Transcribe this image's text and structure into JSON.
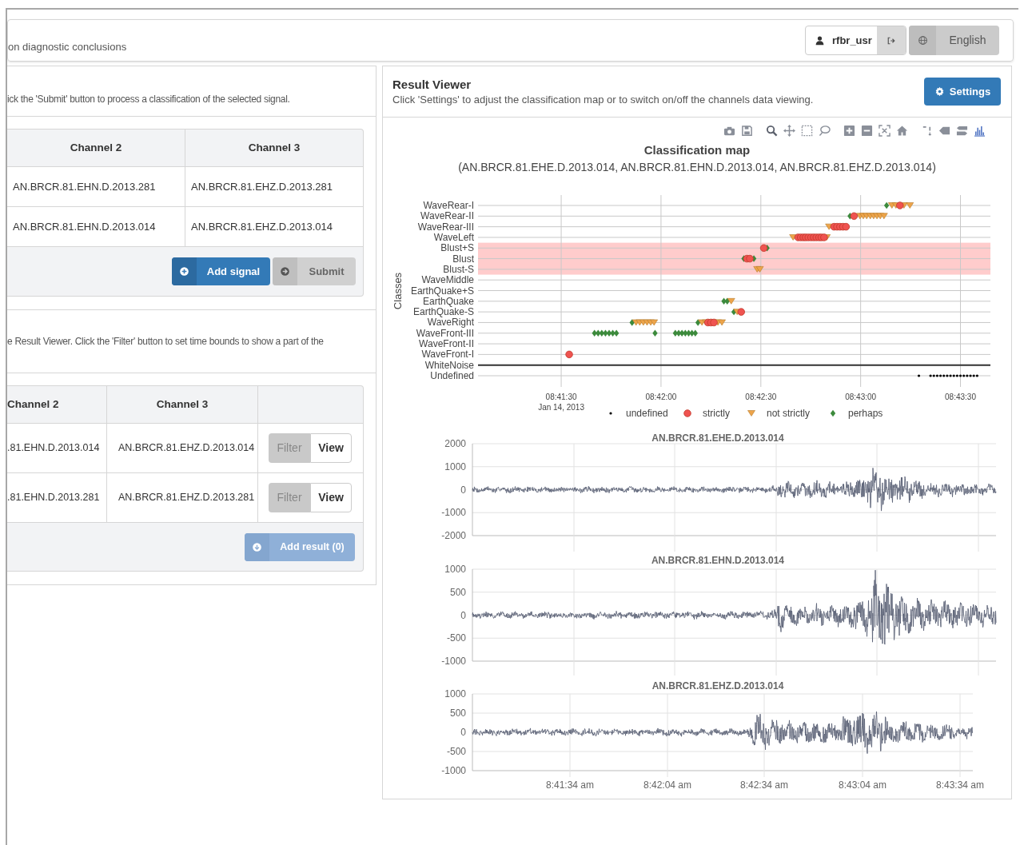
{
  "header": {
    "breadcrumb": "on diagnostic conclusions",
    "username": "rfbr_usr",
    "language": "English"
  },
  "signals_panel": {
    "hint": "ick the 'Submit' button to process a classification of the selected signal.",
    "table": {
      "columns": [
        "Channel 2",
        "Channel 3"
      ],
      "rows": [
        [
          "AN.BRCR.81.EHN.D.2013.281",
          "AN.BRCR.81.EHZ.D.2013.281"
        ],
        [
          "AN.BRCR.81.EHN.D.2013.014",
          "AN.BRCR.81.EHZ.D.2013.014"
        ]
      ]
    },
    "buttons": [
      {
        "label": "Add signal",
        "kind": "primary"
      },
      {
        "label": "Submit",
        "kind": "default"
      }
    ]
  },
  "results_panel": {
    "hint": "e Result Viewer. Click the 'Filter' button to set time bounds to show a part of the",
    "table": {
      "columns": [
        "Channel 2",
        "Channel 3"
      ],
      "rows": [
        {
          "cells": [
            ".81.EHN.D.2013.014",
            "AN.BRCR.81.EHZ.D.2013.014"
          ],
          "actions": [
            {
              "label": "Filter",
              "kind": "toggle"
            },
            {
              "label": "View",
              "kind": "outline"
            }
          ]
        },
        {
          "cells": [
            ".81.EHN.D.2013.281",
            "AN.BRCR.81.EHZ.D.2013.281"
          ],
          "actions": [
            {
              "label": "Filter",
              "kind": "toggle"
            },
            {
              "label": "View",
              "kind": "outline"
            }
          ]
        }
      ]
    },
    "add_button": {
      "label": "Add result (0)",
      "disabled": true
    }
  },
  "result_viewer": {
    "title": "Result Viewer",
    "subtitle": "Click 'Settings' to adjust the classification map or to switch on/off the channels data viewing.",
    "settings_button": "Settings",
    "classification_map": {
      "title": "Classification map",
      "subtitle": "(AN.BRCR.81.EHE.D.2013.014, AN.BRCR.81.EHN.D.2013.014, AN.BRCR.81.EHZ.D.2013.014)",
      "y_title": "Classes",
      "classes": [
        "WaveRear-I",
        "WaveRear-II",
        "WaveRear-III",
        "WaveLeft",
        "Blust+S",
        "Blust",
        "Blust-S",
        "WaveMiddle",
        "EarthQuake+S",
        "EarthQuake",
        "EarthQuake-S",
        "WaveRight",
        "WaveFront-III",
        "WaveFront-II",
        "WaveFront-I",
        "WhiteNoise",
        "Undefined"
      ],
      "time_ticks": [
        "08:41:30",
        "08:42:00",
        "08:42:30",
        "08:43:00",
        "08:43:30"
      ],
      "date_label": "Jan 14, 2013",
      "legend": [
        {
          "name": "undefined",
          "kind": "dot",
          "color": "#000000"
        },
        {
          "name": "strictly",
          "kind": "circle",
          "color": "#ef5350"
        },
        {
          "name": "not strictly",
          "kind": "triangle",
          "color": "#eda44a"
        },
        {
          "name": "perhaps",
          "kind": "diamond",
          "color": "#3c8a3c"
        }
      ]
    },
    "waveforms": [
      {
        "title": "AN.BRCR.81.EHE.D.2013.014",
        "yticks": [
          "2000",
          "1000",
          "0",
          "-1000",
          "-2000"
        ]
      },
      {
        "title": "AN.BRCR.81.EHN.D.2013.014",
        "yticks": [
          "1000",
          "500",
          "0",
          "-500",
          "-1000"
        ]
      },
      {
        "title": "AN.BRCR.81.EHZ.D.2013.014",
        "yticks": [
          "1000",
          "500",
          "0",
          "-500",
          "-1000"
        ]
      }
    ],
    "time_axis": [
      "8:41:34 am",
      "8:42:04 am",
      "8:42:34 am",
      "8:43:04 am",
      "8:43:34 am"
    ]
  }
}
